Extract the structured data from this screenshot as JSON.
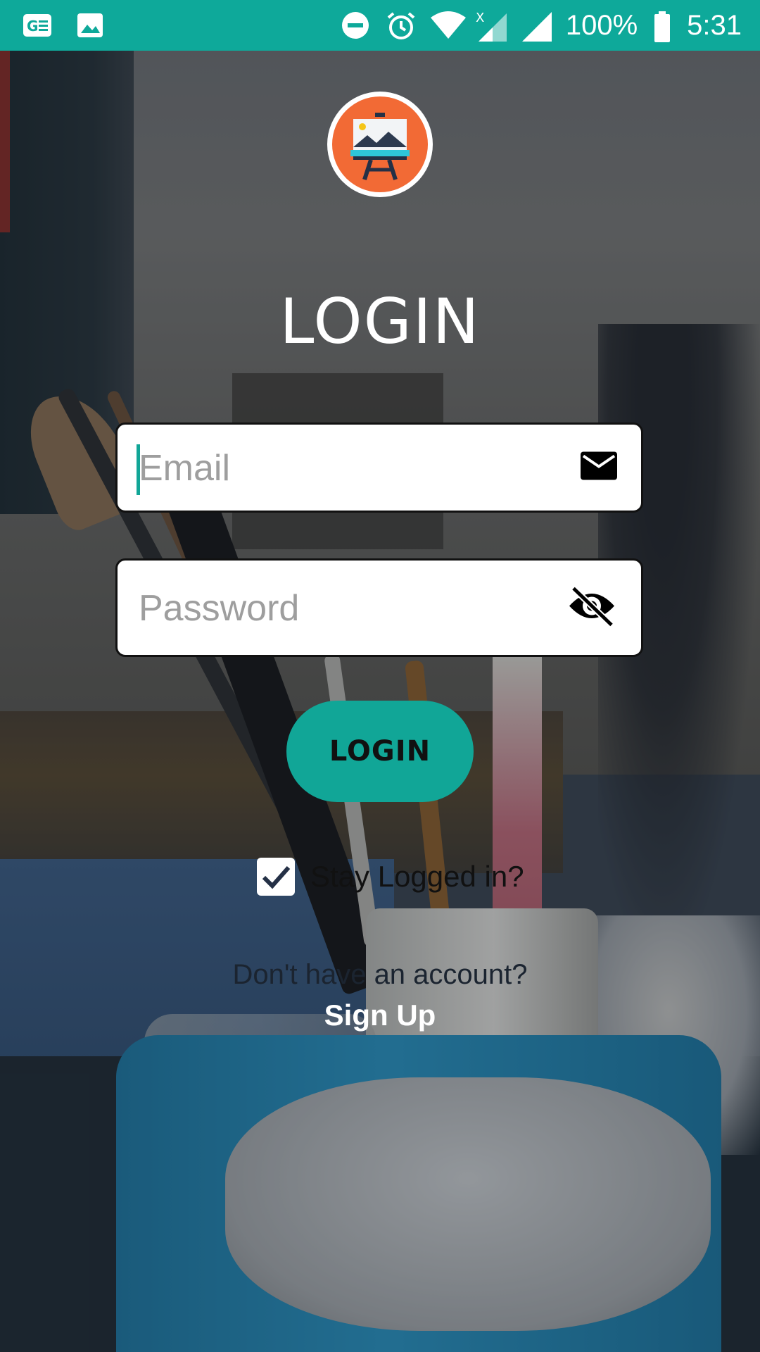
{
  "status_bar": {
    "battery": "100%",
    "time": "5:31",
    "color": "#0ea99a",
    "icons": [
      "ge-news-icon",
      "image-icon",
      "do-not-disturb-icon",
      "alarm-icon",
      "wifi-icon",
      "signal-x-icon",
      "signal-icon",
      "battery-icon"
    ]
  },
  "logo": {
    "icon": "easel-logo-icon",
    "color": "#f26a35"
  },
  "login": {
    "title": "LOGIN",
    "email_placeholder": "Email",
    "email_icon": "mail-icon",
    "password_placeholder": "Password",
    "password_icon": "eye-off-icon",
    "button_label": "LOGIN",
    "button_color": "#11a697",
    "stay_logged_in_label": "Stay Logged in?",
    "stay_logged_in_checked": true
  },
  "signup": {
    "prompt": "Don't have an account?",
    "link_label": "Sign Up"
  }
}
